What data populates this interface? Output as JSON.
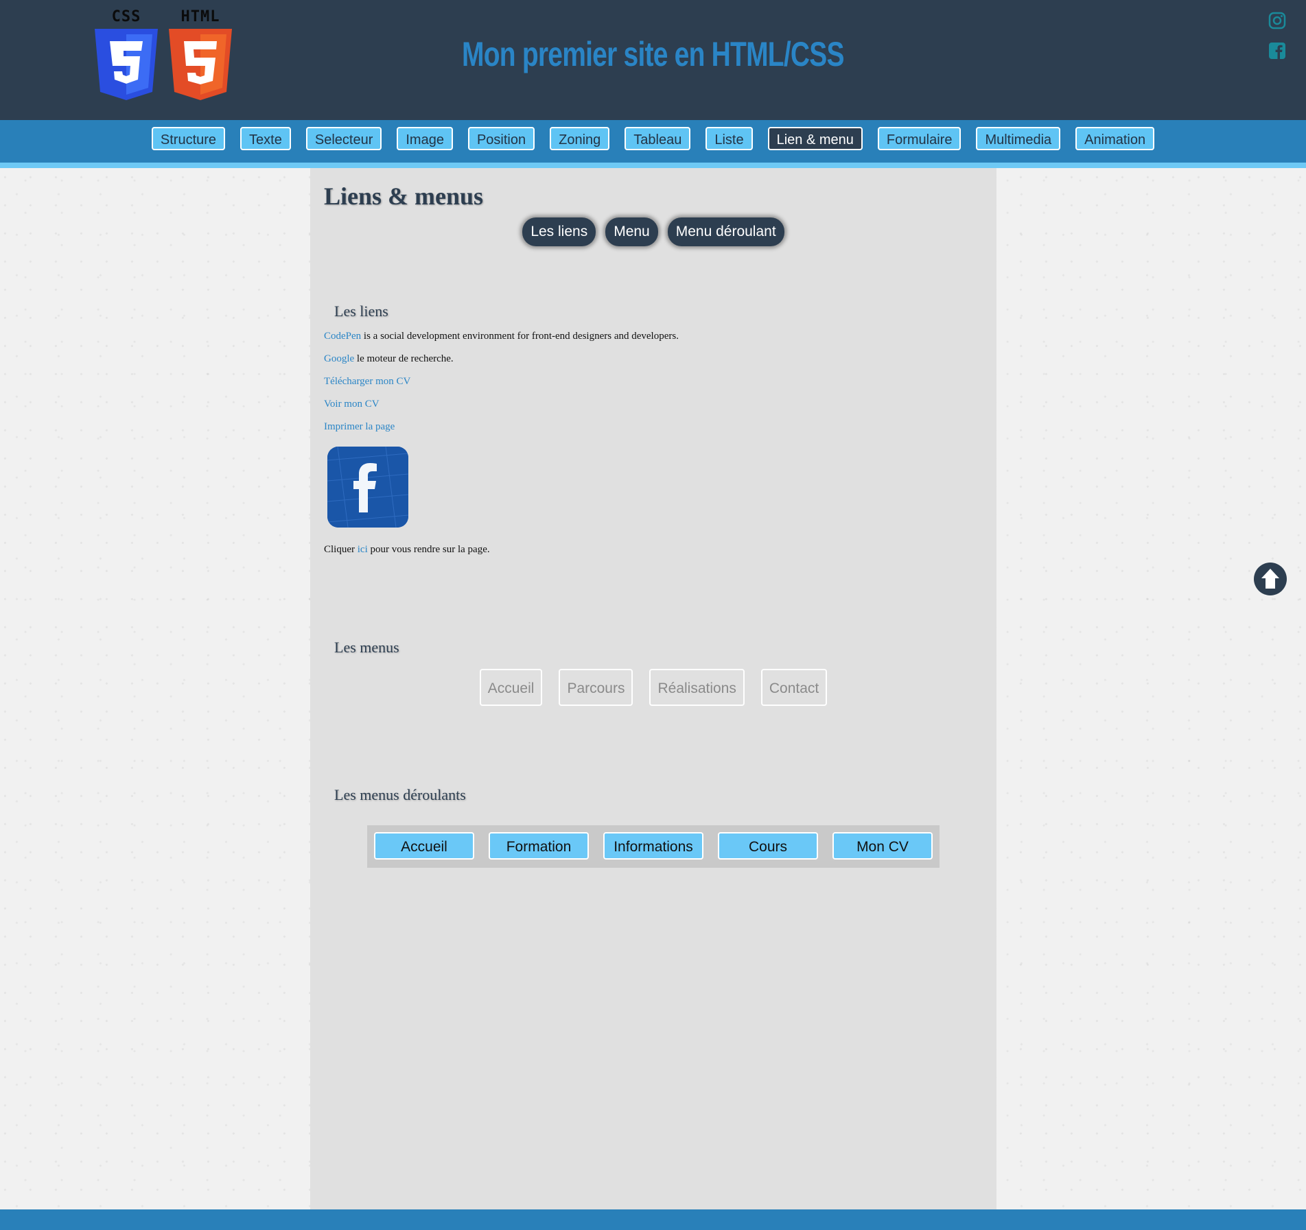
{
  "header": {
    "title": "Mon premier site en HTML/CSS",
    "css_logo_label": "CSS",
    "html_logo_label": "HTML",
    "social": [
      "instagram-icon",
      "facebook-icon"
    ]
  },
  "nav": {
    "items": [
      {
        "label": "Structure"
      },
      {
        "label": "Texte"
      },
      {
        "label": "Selecteur"
      },
      {
        "label": "Image"
      },
      {
        "label": "Position"
      },
      {
        "label": "Zoning"
      },
      {
        "label": "Tableau"
      },
      {
        "label": "Liste"
      },
      {
        "label": "Lien & menu",
        "active": true
      },
      {
        "label": "Formulaire"
      },
      {
        "label": "Multimedia"
      },
      {
        "label": "Animation"
      }
    ]
  },
  "page": {
    "heading": "Liens & menus",
    "anchors": [
      "Les liens",
      "Menu",
      "Menu déroulant"
    ]
  },
  "links_section": {
    "title": "Les liens",
    "codepen_link": "CodePen",
    "codepen_text": " is a social development environment for front-end designers and developers.",
    "google_link": "Google",
    "google_text": " le moteur de recherche.",
    "download_cv": "Télécharger mon CV",
    "view_cv": "Voir mon CV",
    "print_page": "Imprimer la page",
    "click_before": "Cliquer ",
    "click_link": "ici",
    "click_after": " pour vous rendre sur la page."
  },
  "menus_section": {
    "title": "Les menus",
    "items": [
      "Accueil",
      "Parcours",
      "Réalisations",
      "Contact"
    ]
  },
  "dropdown_section": {
    "title": "Les menus déroulants",
    "items": [
      "Accueil",
      "Formation",
      "Informations",
      "Cours",
      "Mon CV"
    ]
  },
  "colors": {
    "header_bg": "#2d3e50",
    "nav_bg": "#2980b9",
    "nav_button": "#5fc4f4",
    "title_blue": "#2a85c6",
    "link_blue": "#2a85c6",
    "social_teal": "#1a8a9a"
  }
}
